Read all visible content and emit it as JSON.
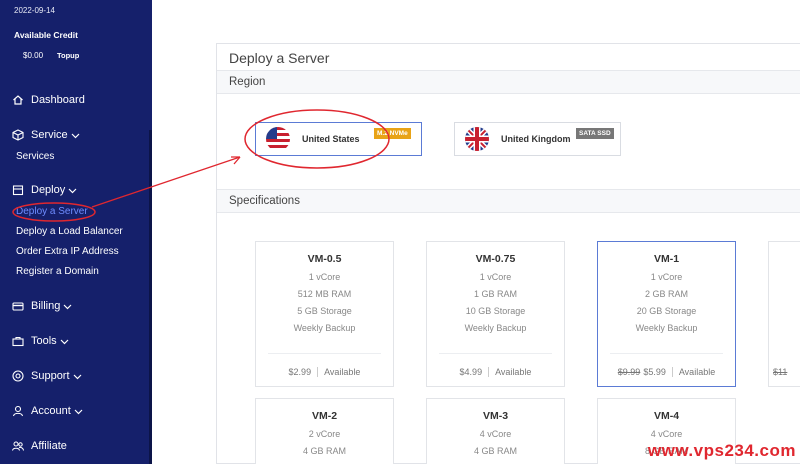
{
  "sidebar": {
    "date": "2022-09-14",
    "credit_title": "Available Credit",
    "credit_amount": "$0.00",
    "topup_label": "Topup",
    "nav": {
      "dashboard": "Dashboard",
      "service": "Service",
      "service_sub": "Services",
      "deploy": "Deploy",
      "deploy_subs": [
        "Deploy a Server",
        "Deploy a Load Balancer",
        "Order Extra IP Address",
        "Register a Domain"
      ],
      "billing": "Billing",
      "tools": "Tools",
      "support": "Support",
      "account": "Account",
      "affiliate": "Affiliate"
    }
  },
  "main": {
    "title": "Deploy a Server",
    "region_section": "Region",
    "regions": [
      {
        "name": "United States",
        "badge": "M.2 NVMe",
        "selected": true
      },
      {
        "name": "United Kingdom",
        "badge": "SATA SSD",
        "selected": false
      }
    ],
    "spec_section": "Specifications",
    "plans": [
      {
        "name": "VM-0.5",
        "cpu": "1 vCore",
        "ram": "512 MB RAM",
        "storage": "5 GB Storage",
        "backup": "Weekly Backup",
        "old_price": "",
        "price": "$2.99",
        "status": "Available"
      },
      {
        "name": "VM-0.75",
        "cpu": "1 vCore",
        "ram": "1 GB RAM",
        "storage": "10 GB Storage",
        "backup": "Weekly Backup",
        "old_price": "",
        "price": "$4.99",
        "status": "Available"
      },
      {
        "name": "VM-1",
        "cpu": "1 vCore",
        "ram": "2 GB RAM",
        "storage": "20 GB Storage",
        "backup": "Weekly Backup",
        "old_price": "$9.99",
        "price": "$5.99",
        "status": "Available"
      },
      {
        "name": "VM-2",
        "cpu": "2 vCore",
        "ram": "4 GB RAM"
      },
      {
        "name": "VM-3",
        "cpu": "4 vCore",
        "ram": "4 GB RAM"
      },
      {
        "name": "VM-4",
        "cpu": "4 vCore",
        "ram": "8 GB RAM"
      }
    ],
    "partial_price": "$11"
  },
  "watermark": "www.vps234.com",
  "colors": {
    "sidebar_bg": "#15206b",
    "accent": "#5b7bd5",
    "annotation": "#e0272f",
    "badge_nvme": "#e8a317"
  }
}
